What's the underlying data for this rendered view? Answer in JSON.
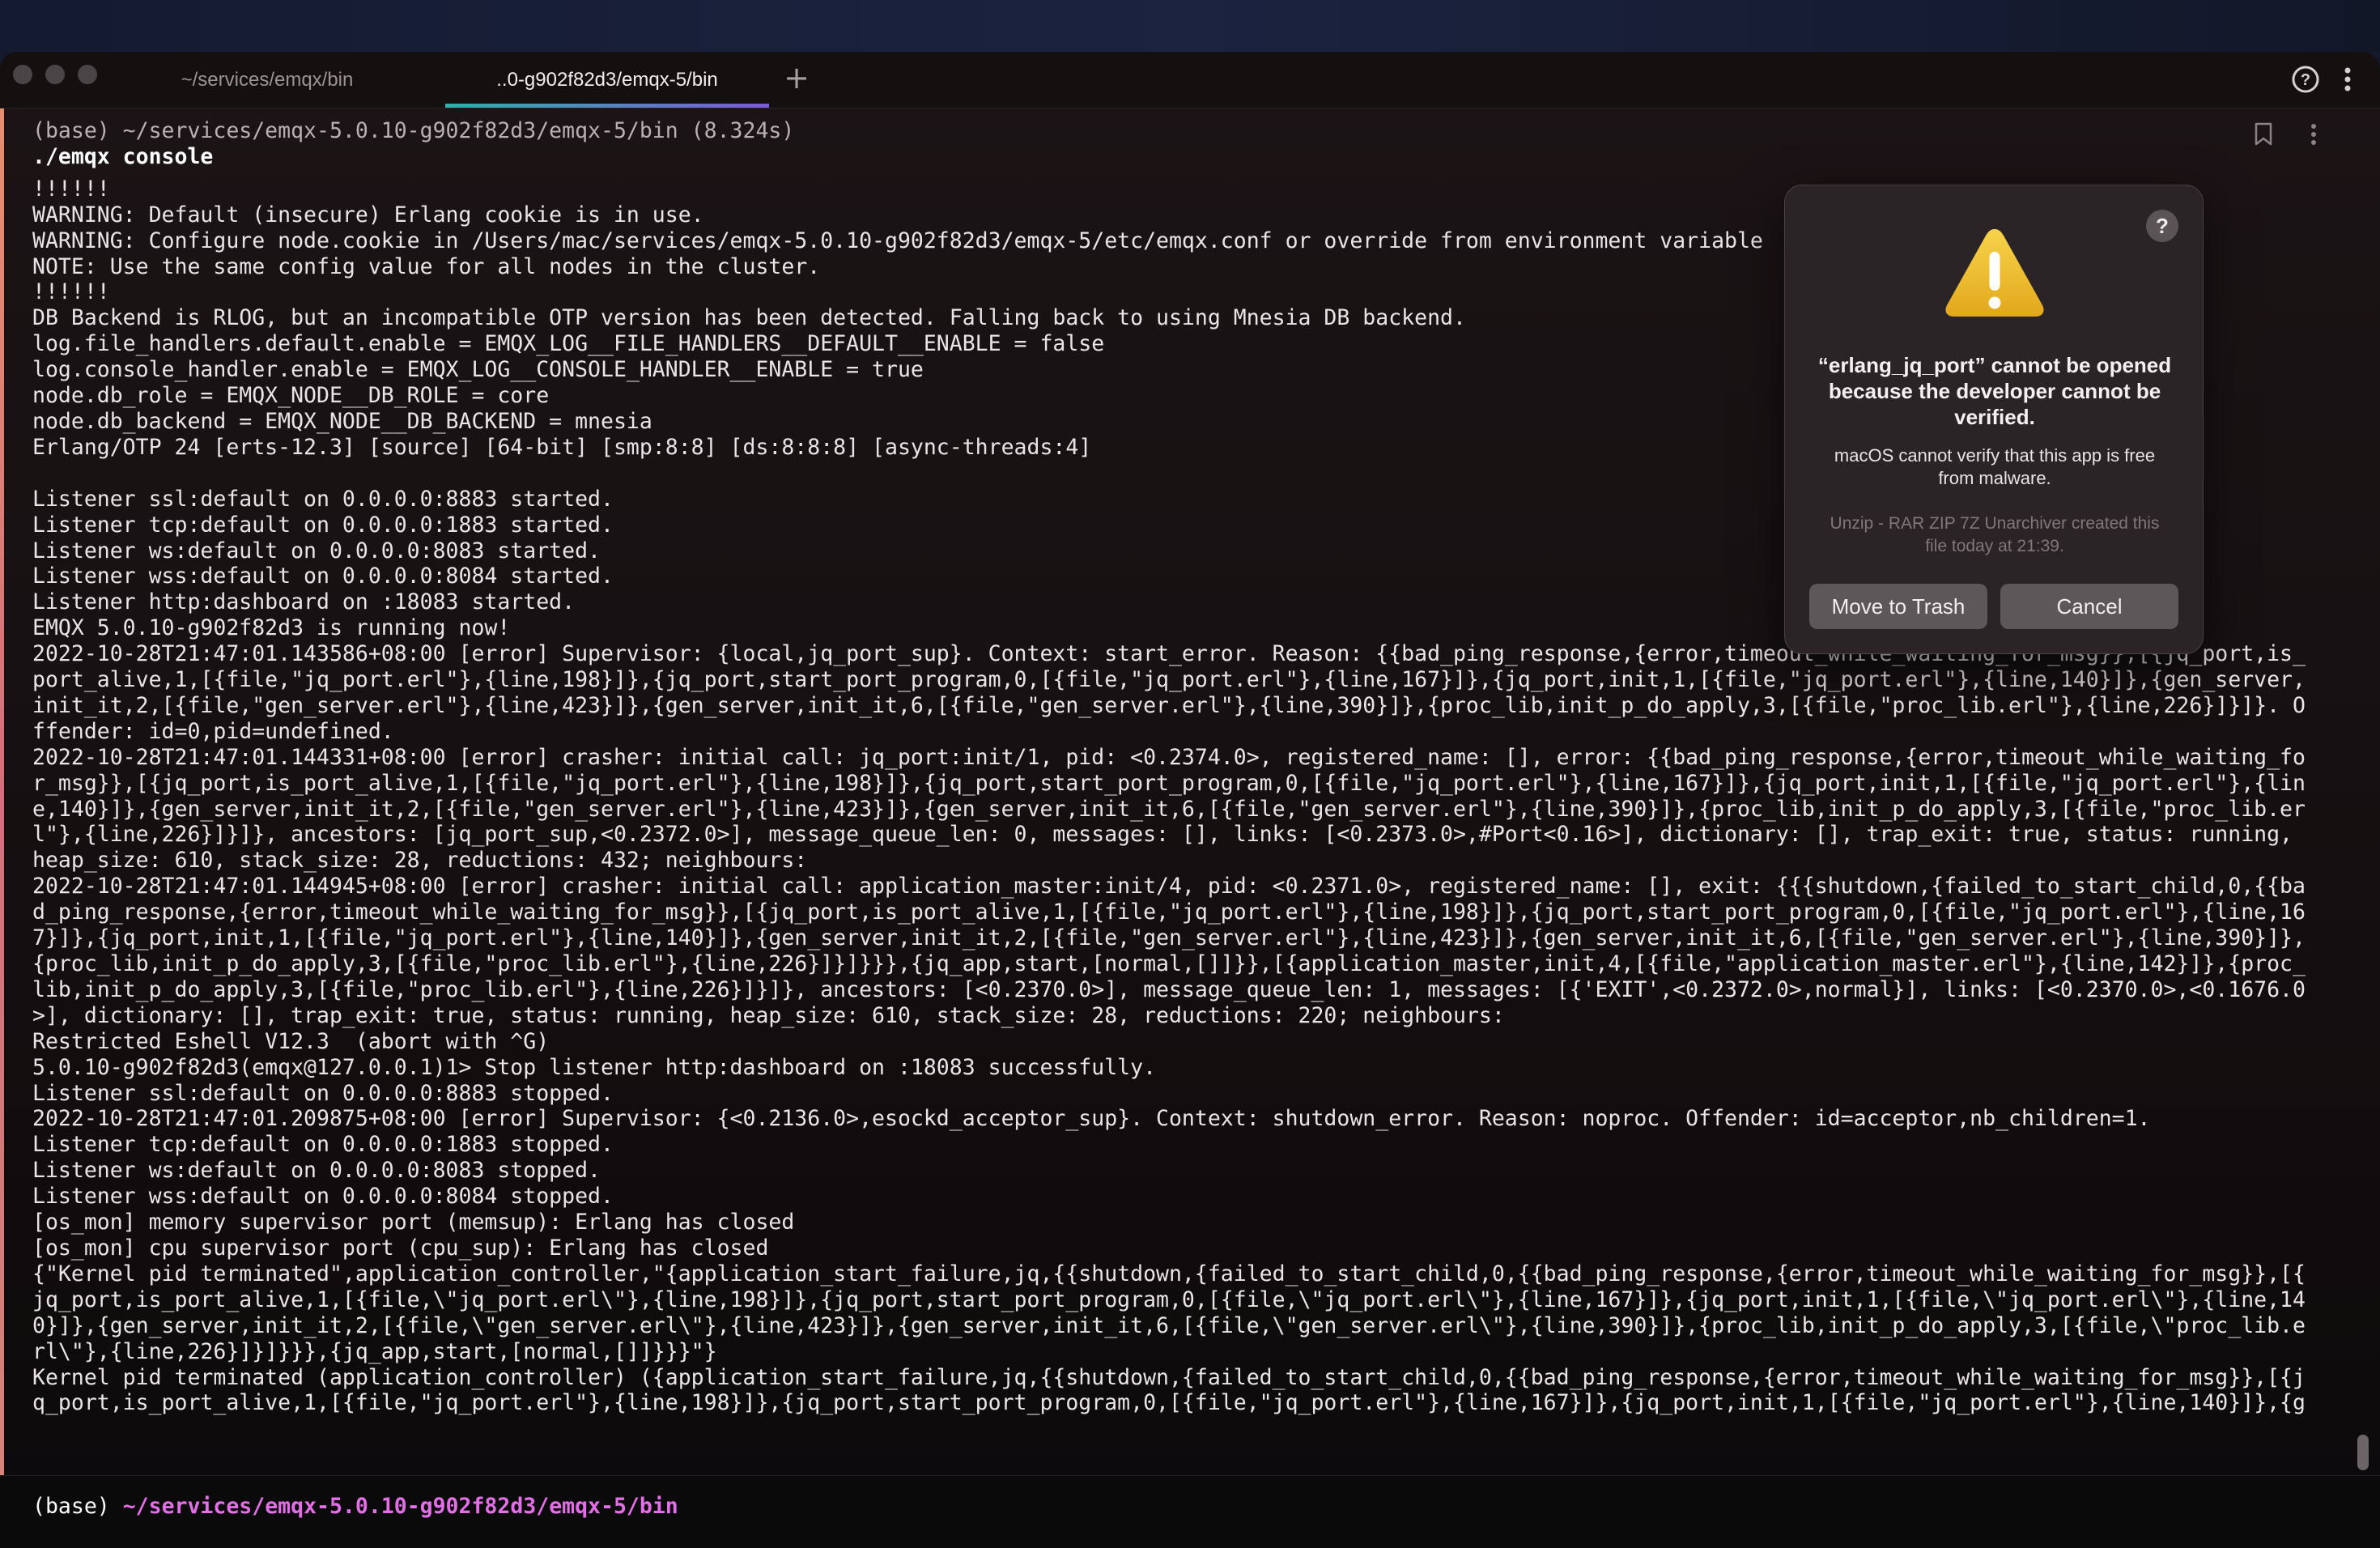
{
  "tabs": [
    {
      "label": "~/services/emqx/bin",
      "active": false
    },
    {
      "label": "..0-g902f82d3/emqx-5/bin",
      "active": true
    }
  ],
  "new_tab_label": "+",
  "block": {
    "header": "(base) ~/services/emqx-5.0.10-g902f82d3/emqx-5/bin (8.324s)",
    "command": "./emqx console",
    "lines": [
      "!!!!!!",
      "WARNING: Default (insecure) Erlang cookie is in use.",
      "WARNING: Configure node.cookie in /Users/mac/services/emqx-5.0.10-g902f82d3/emqx-5/etc/emqx.conf or override from environment variable",
      "NOTE: Use the same config value for all nodes in the cluster.",
      "!!!!!!",
      "DB Backend is RLOG, but an incompatible OTP version has been detected. Falling back to using Mnesia DB backend.",
      "log.file_handlers.default.enable = EMQX_LOG__FILE_HANDLERS__DEFAULT__ENABLE = false",
      "log.console_handler.enable = EMQX_LOG__CONSOLE_HANDLER__ENABLE = true",
      "node.db_role = EMQX_NODE__DB_ROLE = core",
      "node.db_backend = EMQX_NODE__DB_BACKEND = mnesia",
      "Erlang/OTP 24 [erts-12.3] [source] [64-bit] [smp:8:8] [ds:8:8:8] [async-threads:4]",
      "",
      "Listener ssl:default on 0.0.0.0:8883 started.",
      "Listener tcp:default on 0.0.0.0:1883 started.",
      "Listener ws:default on 0.0.0.0:8083 started.",
      "Listener wss:default on 0.0.0.0:8084 started.",
      "Listener http:dashboard on :18083 started.",
      "EMQX 5.0.10-g902f82d3 is running now!",
      "2022-10-28T21:47:01.143586+08:00 [error] Supervisor: {local,jq_port_sup}. Context: start_error. Reason: {{bad_ping_response,{error,timeout_while_waiting_for_msg}},[{jq_port,is_",
      "port_alive,1,[{file,\"jq_port.erl\"},{line,198}]},{jq_port,start_port_program,0,[{file,\"jq_port.erl\"},{line,167}]},{jq_port,init,1,[{file,\"jq_port.erl\"},{line,140}]},{gen_server,",
      "init_it,2,[{file,\"gen_server.erl\"},{line,423}]},{gen_server,init_it,6,[{file,\"gen_server.erl\"},{line,390}]},{proc_lib,init_p_do_apply,3,[{file,\"proc_lib.erl\"},{line,226}]}]}. O",
      "ffender: id=0,pid=undefined.",
      "2022-10-28T21:47:01.144331+08:00 [error] crasher: initial call: jq_port:init/1, pid: <0.2374.0>, registered_name: [], error: {{bad_ping_response,{error,timeout_while_waiting_fo",
      "r_msg}},[{jq_port,is_port_alive,1,[{file,\"jq_port.erl\"},{line,198}]},{jq_port,start_port_program,0,[{file,\"jq_port.erl\"},{line,167}]},{jq_port,init,1,[{file,\"jq_port.erl\"},{lin",
      "e,140}]},{gen_server,init_it,2,[{file,\"gen_server.erl\"},{line,423}]},{gen_server,init_it,6,[{file,\"gen_server.erl\"},{line,390}]},{proc_lib,init_p_do_apply,3,[{file,\"proc_lib.er",
      "l\"},{line,226}]}]}, ancestors: [jq_port_sup,<0.2372.0>], message_queue_len: 0, messages: [], links: [<0.2373.0>,#Port<0.16>], dictionary: [], trap_exit: true, status: running,",
      "heap_size: 610, stack_size: 28, reductions: 432; neighbours:",
      "2022-10-28T21:47:01.144945+08:00 [error] crasher: initial call: application_master:init/4, pid: <0.2371.0>, registered_name: [], exit: {{{shutdown,{failed_to_start_child,0,{{ba",
      "d_ping_response,{error,timeout_while_waiting_for_msg}},[{jq_port,is_port_alive,1,[{file,\"jq_port.erl\"},{line,198}]},{jq_port,start_port_program,0,[{file,\"jq_port.erl\"},{line,16",
      "7}]},{jq_port,init,1,[{file,\"jq_port.erl\"},{line,140}]},{gen_server,init_it,2,[{file,\"gen_server.erl\"},{line,423}]},{gen_server,init_it,6,[{file,\"gen_server.erl\"},{line,390}]},",
      "{proc_lib,init_p_do_apply,3,[{file,\"proc_lib.erl\"},{line,226}]}]}}},{jq_app,start,[normal,[]]}},[{application_master,init,4,[{file,\"application_master.erl\"},{line,142}]},{proc_",
      "lib,init_p_do_apply,3,[{file,\"proc_lib.erl\"},{line,226}]}]}, ancestors: [<0.2370.0>], message_queue_len: 1, messages: [{'EXIT',<0.2372.0>,normal}], links: [<0.2370.0>,<0.1676.0",
      ">], dictionary: [], trap_exit: true, status: running, heap_size: 610, stack_size: 28, reductions: 220; neighbours:",
      "Restricted Eshell V12.3  (abort with ^G)",
      "5.0.10-g902f82d3(emqx@127.0.0.1)1> Stop listener http:dashboard on :18083 successfully.",
      "Listener ssl:default on 0.0.0.0:8883 stopped.",
      "2022-10-28T21:47:01.209875+08:00 [error] Supervisor: {<0.2136.0>,esockd_acceptor_sup}. Context: shutdown_error. Reason: noproc. Offender: id=acceptor,nb_children=1.",
      "Listener tcp:default on 0.0.0.0:1883 stopped.",
      "Listener ws:default on 0.0.0.0:8083 stopped.",
      "Listener wss:default on 0.0.0.0:8084 stopped.",
      "[os_mon] memory supervisor port (memsup): Erlang has closed",
      "[os_mon] cpu supervisor port (cpu_sup): Erlang has closed",
      "{\"Kernel pid terminated\",application_controller,\"{application_start_failure,jq,{{shutdown,{failed_to_start_child,0,{{bad_ping_response,{error,timeout_while_waiting_for_msg}},[{",
      "jq_port,is_port_alive,1,[{file,\\\"jq_port.erl\\\"},{line,198}]},{jq_port,start_port_program,0,[{file,\\\"jq_port.erl\\\"},{line,167}]},{jq_port,init,1,[{file,\\\"jq_port.erl\\\"},{line,14",
      "0}]},{gen_server,init_it,2,[{file,\\\"gen_server.erl\\\"},{line,423}]},{gen_server,init_it,6,[{file,\\\"gen_server.erl\\\"},{line,390}]},{proc_lib,init_p_do_apply,3,[{file,\\\"proc_lib.e",
      "rl\\\"},{line,226}]}]}}},{jq_app,start,[normal,[]]}}}\"}",
      "Kernel pid terminated (application_controller) ({application_start_failure,jq,{{shutdown,{failed_to_start_child,0,{{bad_ping_response,{error,timeout_while_waiting_for_msg}},[{j",
      "q_port,is_port_alive,1,[{file,\"jq_port.erl\"},{line,198}]},{jq_port,start_port_program,0,[{file,\"jq_port.erl\"},{line,167}]},{jq_port,init,1,[{file,\"jq_port.erl\"},{line,140}]},{g"
    ]
  },
  "prompt": {
    "env": "(base)",
    "path": "~/services/emqx-5.0.10-g902f82d3/emqx-5/bin"
  },
  "dialog": {
    "title": "“erlang_jq_port” cannot be opened because the developer cannot be verified.",
    "message": "macOS cannot verify that this app is free from malware.",
    "source": "Unzip - RAR ZIP 7Z Unarchiver created this file today at 21:39.",
    "trash_label": "Move to Trash",
    "cancel_label": "Cancel",
    "help_label": "?"
  },
  "icons": {
    "help": "help-circle-icon",
    "menu": "kebab-menu-icon",
    "bookmark": "bookmark-icon",
    "warning": "warning-triangle-icon"
  },
  "colors": {
    "prompt_path": "#e36ee8",
    "tab_underline_start": "#2fb0a8",
    "tab_underline_end": "#7b5bd6",
    "accent_bar": "#e07a74"
  }
}
